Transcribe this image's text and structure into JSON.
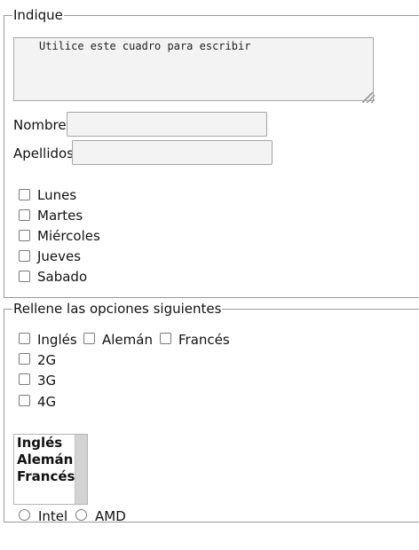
{
  "section1": {
    "legend": "Indique",
    "textarea_value": "Utilice este cuadro para escribir",
    "nombre_label": "Nombre",
    "apellidos_label": "Apellidos",
    "days": [
      "Lunes",
      "Martes",
      "Miércoles",
      "Jueves",
      "Sabado"
    ]
  },
  "section2": {
    "legend": "Rellene las opciones siguientes",
    "languages": [
      "Inglés",
      "Alemán",
      "Francés"
    ],
    "networks": [
      "2G",
      "3G",
      "4G"
    ],
    "list_options": [
      "Inglés",
      "Alemán",
      "Francés"
    ],
    "processors": [
      "Intel",
      "AMD"
    ]
  }
}
